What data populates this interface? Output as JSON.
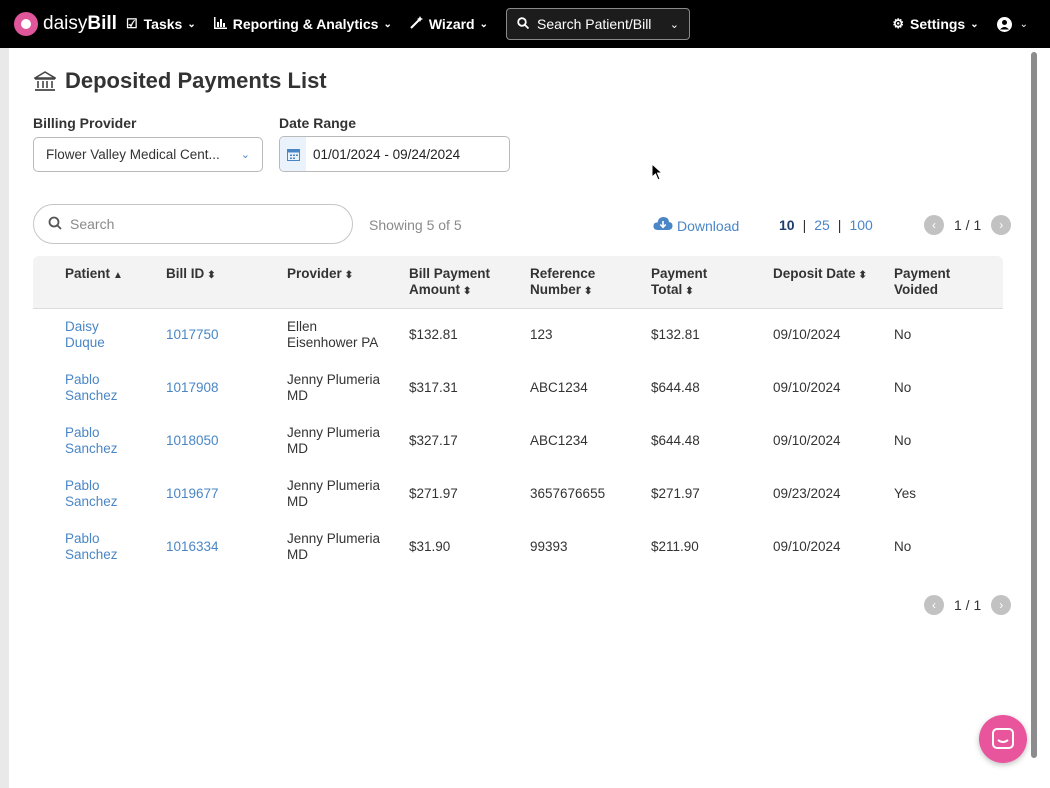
{
  "nav": {
    "logo_prefix": "daisy",
    "logo_suffix": "Bill",
    "tasks": "Tasks",
    "reporting": "Reporting & Analytics",
    "wizard": "Wizard",
    "search": "Search Patient/Bill",
    "settings": "Settings"
  },
  "page": {
    "title": "Deposited Payments List"
  },
  "filters": {
    "billing_provider_label": "Billing Provider",
    "billing_provider_value": "Flower Valley Medical Cent...",
    "date_range_label": "Date Range",
    "date_range_value": "01/01/2024 - 09/24/2024"
  },
  "toolbar": {
    "search_placeholder": "Search",
    "showing": "Showing 5 of 5",
    "download": "Download",
    "page_sizes": [
      "10",
      "25",
      "100"
    ],
    "page_indicator": "1 / 1"
  },
  "table": {
    "headers": {
      "patient": "Patient",
      "bill_id": "Bill ID",
      "provider": "Provider",
      "bill_payment_amount_1": "Bill Payment",
      "bill_payment_amount_2": "Amount",
      "reference_number_1": "Reference",
      "reference_number_2": "Number",
      "payment_total_1": "Payment",
      "payment_total_2": "Total",
      "deposit_date": "Deposit Date",
      "payment_voided_1": "Payment",
      "payment_voided_2": "Voided"
    },
    "rows": [
      {
        "patient_first": "Daisy",
        "patient_last": "Duque",
        "bill_id": "1017750",
        "provider_1": "Ellen",
        "provider_2": "Eisenhower PA",
        "amount": "$132.81",
        "reference": "123",
        "total": "$132.81",
        "deposit_date": "09/10/2024",
        "voided": "No"
      },
      {
        "patient_first": "Pablo",
        "patient_last": "Sanchez",
        "bill_id": "1017908",
        "provider_1": "Jenny Plumeria",
        "provider_2": "MD",
        "amount": "$317.31",
        "reference": "ABC1234",
        "total": "$644.48",
        "deposit_date": "09/10/2024",
        "voided": "No"
      },
      {
        "patient_first": "Pablo",
        "patient_last": "Sanchez",
        "bill_id": "1018050",
        "provider_1": "Jenny Plumeria",
        "provider_2": "MD",
        "amount": "$327.17",
        "reference": "ABC1234",
        "total": "$644.48",
        "deposit_date": "09/10/2024",
        "voided": "No"
      },
      {
        "patient_first": "Pablo",
        "patient_last": "Sanchez",
        "bill_id": "1019677",
        "provider_1": "Jenny Plumeria",
        "provider_2": "MD",
        "amount": "$271.97",
        "reference": "3657676655",
        "total": "$271.97",
        "deposit_date": "09/23/2024",
        "voided": "Yes"
      },
      {
        "patient_first": "Pablo",
        "patient_last": "Sanchez",
        "bill_id": "1016334",
        "provider_1": "Jenny Plumeria",
        "provider_2": "MD",
        "amount": "$31.90",
        "reference": "99393",
        "total": "$211.90",
        "deposit_date": "09/10/2024",
        "voided": "No"
      }
    ]
  },
  "colors": {
    "brand": "#e8559c",
    "link": "#4a86c5",
    "nav_bg": "#000000"
  }
}
